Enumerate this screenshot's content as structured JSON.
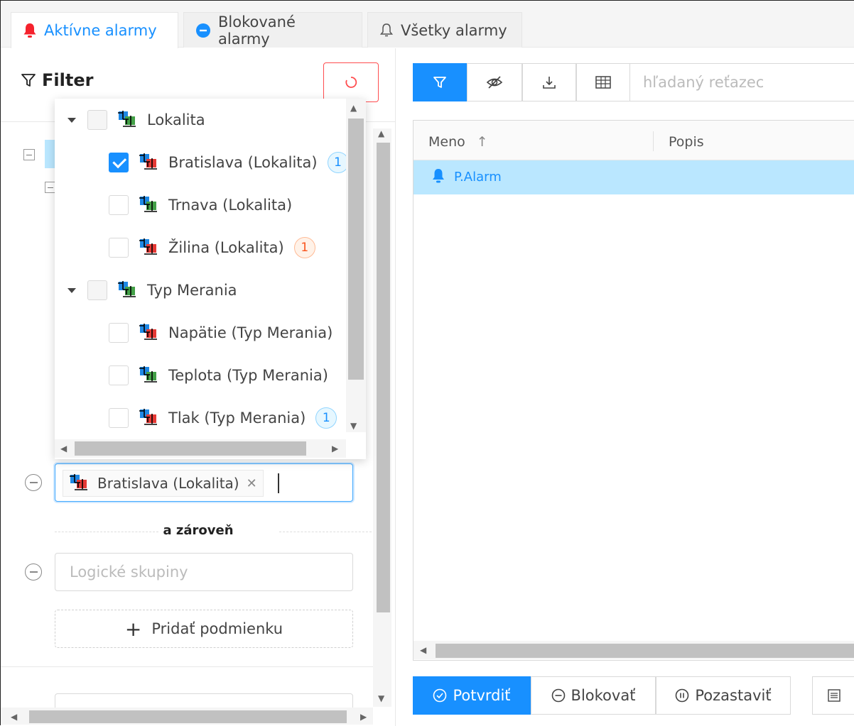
{
  "tabs": [
    {
      "label": "Aktívne alarmy",
      "icon": "bell-filled-icon",
      "active": true
    },
    {
      "label": "Blokované alarmy",
      "icon": "minus-circle-filled-icon",
      "active": false
    },
    {
      "label": "Všetky alarmy",
      "icon": "bell-outline-icon",
      "active": false
    }
  ],
  "filter": {
    "title": "Filter",
    "condition_tag": "Bratislava (Lokalita)",
    "and_label": "a zároveň",
    "logical_groups_placeholder": "Logické skupiny",
    "add_condition": "Pridať podmienku"
  },
  "dropdown": {
    "groups": [
      {
        "label": "Lokalita",
        "items": [
          {
            "label": "Bratislava (Lokalita)",
            "checked": true,
            "badge": "1",
            "badge_color": "blue",
            "icon_color": "#e53935"
          },
          {
            "label": "Trnava (Lokalita)",
            "checked": false,
            "badge": "",
            "icon_color": "#43a047"
          },
          {
            "label": "Žilina (Lokalita)",
            "checked": false,
            "badge": "1",
            "badge_color": "orange",
            "icon_color": "#e53935"
          }
        ]
      },
      {
        "label": "Typ Merania",
        "items": [
          {
            "label": "Napätie (Typ Merania)",
            "checked": false,
            "badge": "",
            "icon_color": "#e53935"
          },
          {
            "label": "Teplota (Typ Merania)",
            "checked": false,
            "badge": "",
            "icon_color": "#43a047"
          },
          {
            "label": "Tlak (Typ Merania)",
            "checked": false,
            "badge": "1",
            "badge_color": "blue",
            "icon_color": "#e53935"
          }
        ]
      }
    ]
  },
  "toolbar": {
    "search_placeholder": "hľadaný reťazec"
  },
  "grid": {
    "columns": [
      "Meno",
      "Popis"
    ],
    "rows": [
      {
        "name": "P.Alarm"
      }
    ]
  },
  "actions": {
    "confirm": "Potvrdiť",
    "block": "Blokovať",
    "pause": "Pozastaviť"
  },
  "colors": {
    "primary": "#1890ff",
    "selected_row": "#bae7ff",
    "danger": "#ff4d4f"
  }
}
